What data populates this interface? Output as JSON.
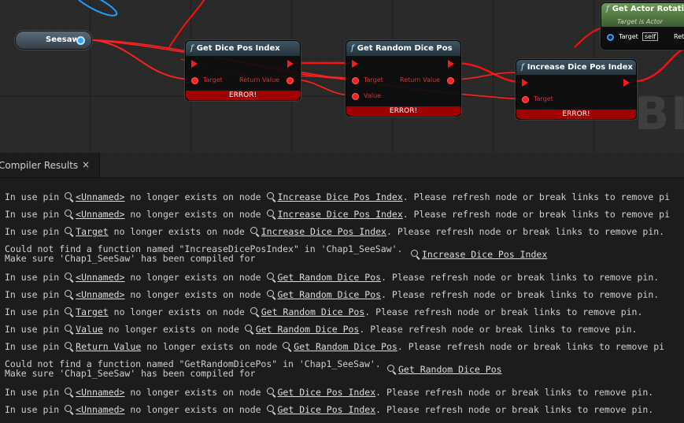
{
  "graph": {
    "watermark": "BL",
    "seesaw_var": "Seesaw",
    "nodes": [
      {
        "title": "Get Dice Pos Index",
        "pins": [
          "Target"
        ],
        "out": "Return Value",
        "error": "ERROR!"
      },
      {
        "title": "Get Random Dice Pos",
        "pins": [
          "Target",
          "Value"
        ],
        "out": "Return Value",
        "error": "ERROR!"
      },
      {
        "title": "Increase Dice Pos Index",
        "pins": [
          "Target"
        ],
        "error": "ERROR!"
      },
      {
        "title": "Get Actor Rotation",
        "subtitle": "Target is Actor",
        "pins": [
          "Target"
        ],
        "self": "self",
        "out": "Ret"
      }
    ],
    "func_glyph": "f"
  },
  "panel": {
    "tab_label": "Compiler Results",
    "close_glyph": "×"
  },
  "log": [
    {
      "pre": "In use pin ",
      "pin": "<Unnamed>",
      "mid": " no longer exists on node ",
      "node": "Increase Dice Pos Index",
      "post": ". Please refresh node or break links to remove pi"
    },
    {
      "pre": "In use pin ",
      "pin": "<Unnamed>",
      "mid": " no longer exists on node ",
      "node": "Increase Dice Pos Index",
      "post": ". Please refresh node or break links to remove pi"
    },
    {
      "pre": "In use pin ",
      "pin": "Target",
      "mid": " no longer exists on node ",
      "node": "Increase Dice Pos Index",
      "post": ". Please refresh node or break links to remove pin."
    },
    {
      "line1": "Could not find a function named \"IncreaseDicePosIndex\" in 'Chap1_SeeSaw'.",
      "line2": "Make sure 'Chap1_SeeSaw' has been compiled for",
      "node": "Increase Dice Pos Index"
    },
    {
      "pre": "In use pin ",
      "pin": "<Unnamed>",
      "mid": " no longer exists on node ",
      "node": "Get Random Dice Pos",
      "post": ". Please refresh node or break links to remove pin."
    },
    {
      "pre": "In use pin ",
      "pin": "<Unnamed>",
      "mid": " no longer exists on node ",
      "node": "Get Random Dice Pos",
      "post": ". Please refresh node or break links to remove pin."
    },
    {
      "pre": "In use pin ",
      "pin": "Target",
      "mid": " no longer exists on node ",
      "node": "Get Random Dice Pos",
      "post": ". Please refresh node or break links to remove pin."
    },
    {
      "pre": "In use pin ",
      "pin": "Value",
      "mid": " no longer exists on node ",
      "node": "Get Random Dice Pos",
      "post": ". Please refresh node or break links to remove pin."
    },
    {
      "pre": "In use pin ",
      "pin": "Return Value",
      "mid": " no longer exists on node ",
      "node": "Get Random Dice Pos",
      "post": ". Please refresh node or break links to remove pi"
    },
    {
      "line1": "Could not find a function named \"GetRandomDicePos\" in 'Chap1_SeeSaw'.",
      "line2": "Make sure 'Chap1_SeeSaw' has been compiled for",
      "node": "Get Random Dice Pos"
    },
    {
      "pre": "In use pin ",
      "pin": "<Unnamed>",
      "mid": " no longer exists on node ",
      "node": "Get Dice Pos Index",
      "post": ". Please refresh node or break links to remove pin."
    },
    {
      "pre": "In use pin ",
      "pin": "<Unnamed>",
      "mid": " no longer exists on node ",
      "node": "Get Dice Pos Index",
      "post": ". Please refresh node or break links to remove pin."
    }
  ],
  "colors": {
    "exec": "#ff1a1a",
    "error_bar": "#a00000",
    "object_pin": "#2aa7ff"
  }
}
